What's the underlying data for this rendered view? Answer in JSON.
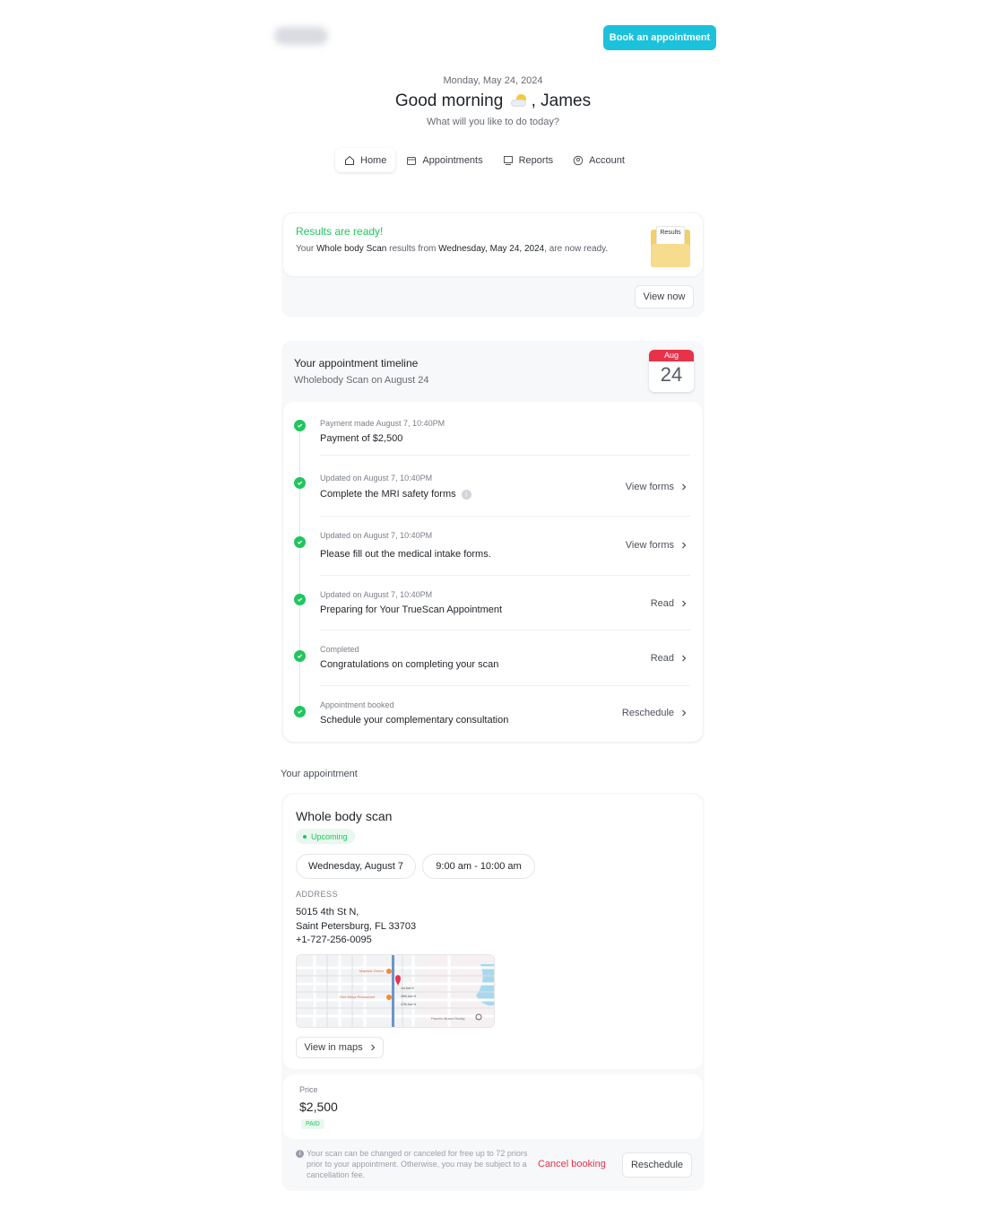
{
  "header": {
    "book_label": "Book an appointment",
    "date": "Monday, May 24, 2024",
    "greeting_prefix": "Good morning",
    "greeting_name": ", James",
    "subtitle": "What will you like to do today?"
  },
  "tabs": [
    {
      "label": "Home",
      "icon": "home-icon"
    },
    {
      "label": "Appointments",
      "icon": "calendar-icon"
    },
    {
      "label": "Reports",
      "icon": "report-icon"
    },
    {
      "label": "Account",
      "icon": "account-icon"
    }
  ],
  "results": {
    "title": "Results are ready!",
    "text_1": "Your ",
    "scan": "Whole body Scan",
    "text_2": " results from ",
    "date": "Wednesday, May 24, 2024",
    "text_3": ", are now ready.",
    "folder_label": "Results",
    "view_label": "View now"
  },
  "timeline": {
    "title": "Your appointment timeline",
    "subtitle": "Wholebody Scan on August 24",
    "cal_month": "Aug",
    "cal_day": "24",
    "steps": [
      {
        "meta": "Payment made August 7, 10:40PM",
        "main": "Payment of $2,500",
        "action": ""
      },
      {
        "meta": "Updated on August 7, 10:40PM",
        "main": "Complete the MRI safety forms",
        "action": "View forms"
      },
      {
        "meta": "Updated on August 7, 10:40PM",
        "main": "Please fill out the medical intake forms.",
        "action": "View forms"
      },
      {
        "meta": "Updated on August 7, 10:40PM",
        "main": "Preparing for Your TrueScan Appointment",
        "action": "Read"
      },
      {
        "meta": "Completed",
        "main": "Congratulations on completing your scan",
        "action": "Read"
      },
      {
        "meta": "Appointment booked",
        "main": "Schedule your complementary consultation",
        "action": "Reschedule"
      }
    ]
  },
  "appointment": {
    "section_label": "Your appointment",
    "title": "Whole body scan",
    "status": "Upcoming",
    "date": "Wednesday, August 7",
    "time": "9:00 am - 10:00 am",
    "address_label": "ADDRESS",
    "address_line1": "5015 4th St N,",
    "address_line2": "Saint Petersburg, FL 33703",
    "phone": "+1-727-256-0095",
    "maps_label": "View in maps",
    "map_labels": {
      "place1": "Majestic Green",
      "place2": "Red Mesa Restaurant",
      "place3": "Pancho Bravo Realty",
      "street1": "1st Ave N",
      "street2": "49th Ave N",
      "street3": "47th Ave N"
    },
    "price_label": "Price",
    "price": "$2,500",
    "paid": "PAID",
    "note": "Your scan can be changed or canceled for free up to 72 priors prior to your appointment. Otherwise, you may be subject to a cancellation fee.",
    "cancel_label": "Cancel booking",
    "reschedule_label": "Reschedule"
  },
  "colors": {
    "accent": "#1cc1dc",
    "success": "#22c55e",
    "danger": "#e8324a"
  }
}
